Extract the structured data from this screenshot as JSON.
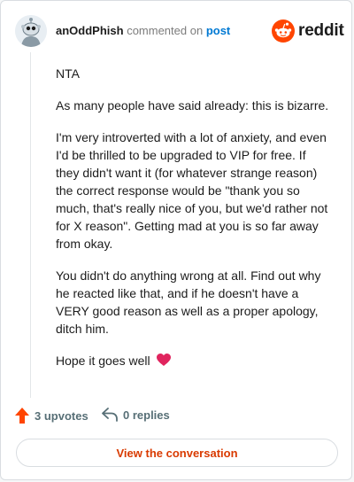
{
  "comment": {
    "username": "anOddPhish",
    "action_text": "commented on",
    "post_link": "post",
    "paragraphs": [
      "NTA",
      "As many people have said already: this is bizarre.",
      "I'm very introverted with a lot of anxiety, and even I'd be thrilled to be upgraded to VIP for free. If they didn't want it (for whatever strange reason) the correct response would be \"thank you so much, that's really nice of you, but we'd rather not for X reason\". Getting mad at you is so far away from okay.",
      "You didn't do anything wrong at all. Find out why he reacted like that, and if he doesn't have a VERY good reason as well as a proper apology, ditch him."
    ],
    "closing": "Hope it goes well",
    "closing_emoji": "❤️"
  },
  "brand": {
    "name": "reddit",
    "color": "#ff4500"
  },
  "actions": {
    "upvotes": "3 upvotes",
    "replies": "0 replies"
  },
  "cta": {
    "label": "View the conversation"
  },
  "colors": {
    "accent": "#d93a00",
    "link": "#0079d3",
    "upvote": "#ff4500"
  }
}
